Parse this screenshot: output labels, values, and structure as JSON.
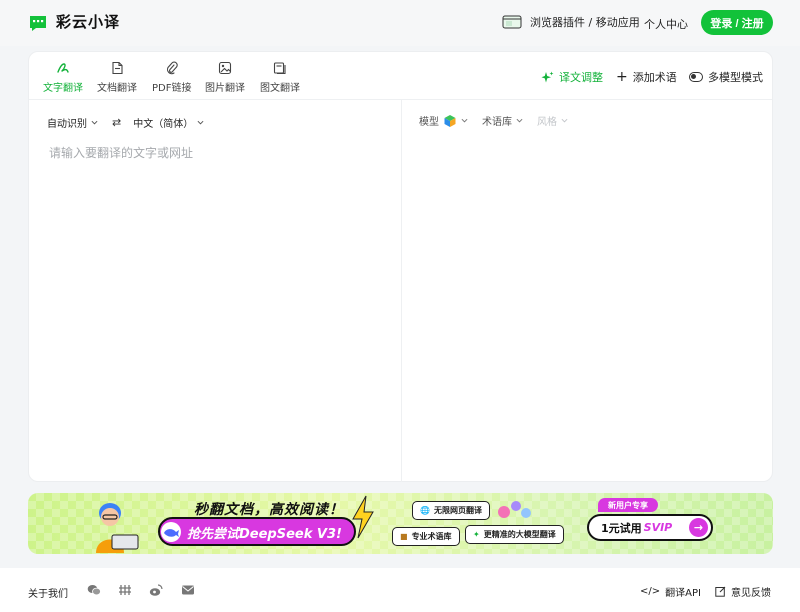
{
  "header": {
    "app_name": "彩云小译",
    "plugins_label": "浏览器插件 / 移动应用",
    "personal_label": "个人中心",
    "login_label": "登录 / 注册",
    "brand_color": "#12c23a"
  },
  "tabs": [
    {
      "label": "文字翻译",
      "icon": "pen-icon",
      "active": true
    },
    {
      "label": "文档翻译",
      "icon": "document-icon",
      "active": false
    },
    {
      "label": "PDF链接",
      "icon": "paperclip-icon",
      "active": false
    },
    {
      "label": "图片翻译",
      "icon": "image-icon",
      "active": false
    },
    {
      "label": "图文翻译",
      "icon": "image-text-icon",
      "active": false
    }
  ],
  "actions": {
    "adjust_label": "译文调整",
    "add_term_label": "添加术语",
    "multi_model_label": "多模型模式"
  },
  "source": {
    "lang_from": "自动识别",
    "lang_to": "中文（简体）",
    "placeholder": "请输入要翻译的文字或网址",
    "value": ""
  },
  "target": {
    "model_label": "模型",
    "termbase_label": "术语库",
    "style_label": "风格"
  },
  "banner": {
    "title": "秒翻文档，高效阅读！",
    "pill_text": "抢先尝试DeepSeek V3!",
    "tag1": "无限网页翻译",
    "tag2": "专业术语库",
    "tag3": "更精准的大模型翻译",
    "new_user": "新用户专享",
    "cta_prefix": "1元试用",
    "cta_vip": "SVIP",
    "cta_arrow": "→"
  },
  "footer": {
    "about": "关于我们",
    "api_label": "翻译API",
    "feedback_label": "意见反馈"
  }
}
